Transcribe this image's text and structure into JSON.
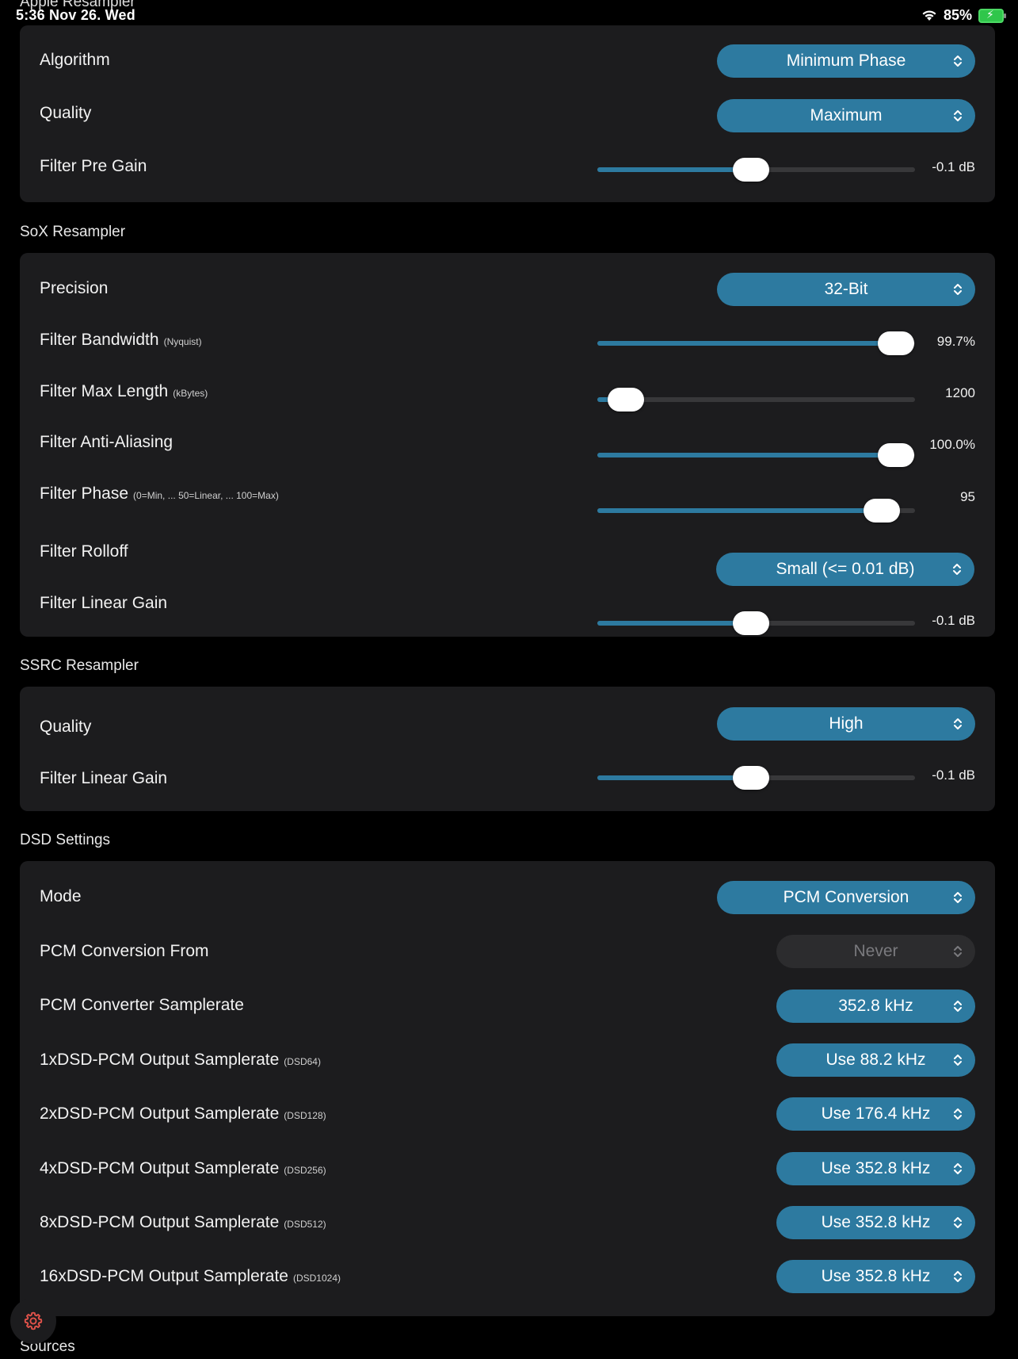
{
  "status_bar": {
    "time": "5:36  Nov 26. Wed",
    "battery": "85%",
    "peek_title": "Apple Resampler"
  },
  "apple": {
    "algorithm_label": "Algorithm",
    "algorithm_value": "Minimum Phase",
    "quality_label": "Quality",
    "quality_value": "Maximum",
    "pregain_label": "Filter Pre Gain",
    "pregain_value": "-0.1 dB",
    "pregain_fraction": 0.485
  },
  "sox": {
    "header": "SoX Resampler",
    "precision_label": "Precision",
    "precision_value": "32-Bit",
    "bandwidth_label": "Filter Bandwidth",
    "bandwidth_sub": "(Nyquist)",
    "bandwidth_value": "99.7%",
    "bandwidth_fraction": 0.94,
    "maxlen_label": "Filter Max Length",
    "maxlen_sub": "(kBytes)",
    "maxlen_value": "1200",
    "maxlen_fraction": 0.09,
    "antialias_label": "Filter Anti-Aliasing",
    "antialias_value": "100.0%",
    "antialias_fraction": 0.94,
    "phase_label": "Filter Phase",
    "phase_sub": "(0=Min, ... 50=Linear, ... 100=Max)",
    "phase_value": "95",
    "phase_fraction": 0.895,
    "rolloff_label": "Filter Rolloff",
    "rolloff_value": "Small (<= 0.01 dB)",
    "lingain_label": "Filter Linear Gain",
    "lingain_value": "-0.1 dB",
    "lingain_fraction": 0.485
  },
  "ssrc": {
    "header": "SSRC Resampler",
    "quality_label": "Quality",
    "quality_value": "High",
    "lingain_label": "Filter Linear Gain",
    "lingain_value": "-0.1 dB",
    "lingain_fraction": 0.485
  },
  "dsd": {
    "header": "DSD Settings",
    "mode_label": "Mode",
    "mode_value": "PCM Conversion",
    "from_label": "PCM Conversion From",
    "from_value": "Never",
    "samplerate_label": "PCM Converter Samplerate",
    "samplerate_value": "352.8 kHz",
    "rows": [
      {
        "label": "1xDSD-PCM Output Samplerate",
        "sub": "(DSD64)",
        "value": "Use 88.2 kHz"
      },
      {
        "label": "2xDSD-PCM Output Samplerate",
        "sub": "(DSD128)",
        "value": "Use 176.4 kHz"
      },
      {
        "label": "4xDSD-PCM Output Samplerate",
        "sub": "(DSD256)",
        "value": "Use 352.8 kHz"
      },
      {
        "label": "8xDSD-PCM Output Samplerate",
        "sub": "(DSD512)",
        "value": "Use 352.8 kHz"
      },
      {
        "label": "16xDSD-PCM Output Samplerate",
        "sub": "(DSD1024)",
        "value": "Use 352.8 kHz"
      }
    ]
  },
  "sources_header": "Sources",
  "icons": {
    "fab": "gear-icon",
    "chevron": "chevron-updown-icon"
  },
  "colors": {
    "accent": "#2d7aa0",
    "card": "#1c1c1e",
    "fab_icon": "#e0524a"
  }
}
